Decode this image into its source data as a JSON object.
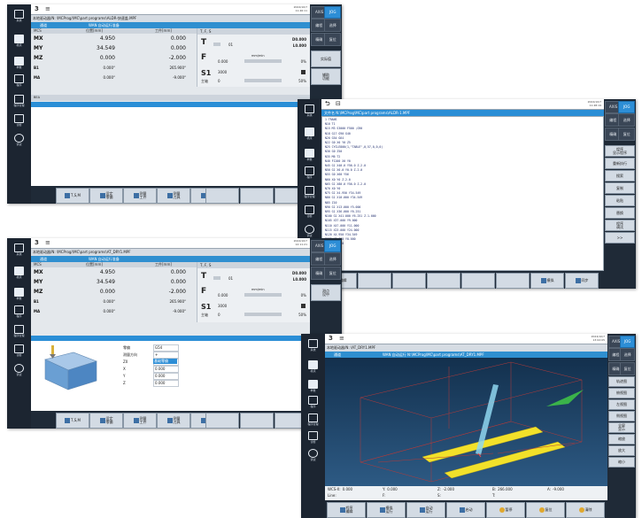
{
  "w1": {
    "title_sym": "3",
    "title_icon": "≡",
    "datetime": "2024/10/7\n11:46:11",
    "path": "本地驱动器/N: \\MCProg/\\MC\\part programs\\ALDR-快速盖.MPF",
    "status_left": "通道",
    "status_right": "WAN 自动运行准备",
    "col_mcs": "MCS",
    "col_pos": "位置[mm]",
    "col_work": "工件[mm]",
    "col_tfs": "T, F, S",
    "axes": [
      {
        "n": "MX",
        "v1": "4.950",
        "v2": "0.000"
      },
      {
        "n": "MY",
        "v1": "34.549",
        "v2": "0.000"
      },
      {
        "n": "MZ",
        "v1": "0.000",
        "v2": "-2.000"
      },
      {
        "n": "B1",
        "v1": "0.000°",
        "v2": "265.900°"
      },
      {
        "n": "MA",
        "v1": "0.000°",
        "v2": "-9.000°"
      }
    ],
    "t_label": "T",
    "t_val": "01",
    "t_d": "D0.000",
    "t_l": "L0.000",
    "f_label": "F",
    "f_val": "0.000",
    "f_unit": "mm/min",
    "f_pct": "0%",
    "s_label": "S1",
    "s_val": "3000",
    "s_pct": "50%",
    "spindle": "主轴",
    "spindle_val": "0",
    "row_bar": "BEA",
    "right_top": [
      "AXIS",
      "JOG"
    ],
    "right_btns": [
      "编程",
      "选择",
      "精确",
      "复位",
      "实际值",
      "辅助\n功能"
    ],
    "bottom_btns": [
      "T,S,M",
      "设定\n零偏",
      "测量\n工件",
      "测量\n刀具",
      "位置"
    ]
  },
  "w2": {
    "title_sym": "⮌",
    "title_icon": "⊟",
    "datetime": "2024/10/7\n11:48:19",
    "path": "文件名  N:\\MCProg\\MC\\part programs\\ALDR-1.MPF",
    "code": [
      "1 TRANS",
      "N10 T1",
      "N15 M3 S3000 F500 ;G90",
      "N18 G17 G90 G40",
      "N20 G54 G64",
      "N22 G0 X0 Y0 Z5",
      "N25 CYCLE800(1,\"TABLE\",0,57,0,0,0)",
      "N30 G0 Z50",
      "N35 M6 T2",
      "N40 F1200 X0 Y0",
      "N45 G1 X40.0 Y56.0 Z-2.0",
      "N50 G1 X0.0 Y0.0 Z-2.0",
      "N55 G0 X60 Y56",
      "N60 X0 Y0 Z-2.0",
      "N65 G1 X80.0 Y56.0 Z-2.0",
      "N70 X0 Y0",
      "N75 G1 X4.950 Y34.549",
      "N80 G1 X10.000 Y34.549",
      "N85 Z10",
      "N90 G1 X13.000 Y5.000",
      "N95 G1 X36.000 Y6.251",
      "N100 G1 X41.000 Y6.251 Z-1.000",
      "N105 X37.000 Y9.000",
      "N110 X47.000 Y11.000",
      "N115 X23.000 Y24.000",
      "N120 X4.950 Y34.549",
      "N125 X0.000 Y0.000",
      "N130 G0 Z50",
      "N135 M30",
      "N140 Z50"
    ],
    "right_top": [
      "AXIS",
      "JOG"
    ],
    "right_btns": [
      "编程",
      "选择",
      "精确",
      "复位",
      "程序\n显示程序",
      "重新执行",
      "搜索",
      "复制",
      "粘贴",
      "替换",
      "程序\n调试",
      ">>"
    ],
    "bottom_btns": [
      "编辑",
      "模拟",
      "同步"
    ]
  },
  "w3": {
    "title_sym": "3",
    "title_icon": "≡",
    "datetime": "2024/10/7\n12:11:21",
    "path": "本地驱动器/N: \\MCProg/\\MC\\part programs\\AT_DRY1.MPF",
    "status_left": "通道",
    "status_right": "WAN 自动运行准备",
    "col_mcs": "MCS",
    "col_pos": "位置[mm]",
    "col_work": "工件[mm]",
    "col_tfs": "T, F, S",
    "axes": [
      {
        "n": "MX",
        "v1": "4.950",
        "v2": "0.000"
      },
      {
        "n": "MY",
        "v1": "34.549",
        "v2": "0.000"
      },
      {
        "n": "MZ",
        "v1": "0.000",
        "v2": "-2.000"
      },
      {
        "n": "B1",
        "v1": "0.000°",
        "v2": "265.900°"
      },
      {
        "n": "MA",
        "v1": "0.000°",
        "v2": "-9.000°"
      }
    ],
    "t_label": "T",
    "t_val": "01",
    "t_d": "D0.000",
    "t_l": "L0.000",
    "f_label": "F",
    "f_val": "0.000",
    "f_unit": "mm/min",
    "f_pct": "0%",
    "s_label": "S1",
    "s_val": "3000",
    "s_pct": "50%",
    "spindle": "主轴",
    "spindle_val": "0",
    "form_labels": [
      "零偏",
      "测量方向",
      "Z0",
      "X",
      "Y",
      "Z"
    ],
    "form_vals": [
      "G54",
      "+",
      "0.000",
      "0.000",
      "0.000",
      "0.000"
    ],
    "form_selected": "基础零偏",
    "right_top": [
      "AXIS",
      "JOG"
    ],
    "right_btns": [
      "编程",
      "选择",
      "精确",
      "复位",
      "测点\n设中"
    ],
    "bottom_btns": [
      "T,S,M",
      "设定\n零偏",
      "测量\n工件",
      "测量\n刀具",
      "位置"
    ]
  },
  "w4": {
    "title_sym": "3",
    "title_icon": "≡",
    "datetime": "2024/10/7\n13:02:05",
    "path": "本地驱动器/N: \\AT_DRY1.MPF",
    "status_left": "通道",
    "status_right": "WAN 自动运行 N:\\MCProg\\MC\\part programs\\AT_DRY1.MPF",
    "readout": [
      {
        "k": "WCS-X:",
        "v": "0.000"
      },
      {
        "k": "Y:",
        "v": "0.000"
      },
      {
        "k": "Z:",
        "v": "-2.000"
      },
      {
        "k": "B:",
        "v": "266.000"
      },
      {
        "k": "A:",
        "v": "-9.000"
      }
    ],
    "readout2": [
      {
        "k": "Line:",
        "v": ""
      },
      {
        "k": "F:",
        "v": ""
      },
      {
        "k": "S:",
        "v": ""
      },
      {
        "k": "T:",
        "v": ""
      }
    ],
    "right_top": [
      "AXIS",
      "JOG"
    ],
    "right_btns": [
      "编程",
      "选择",
      "精确",
      "复位",
      "轨迹图",
      "俯视图",
      "左视图",
      "侧视图",
      "全屏\n显示",
      "缩放",
      "放大",
      "缩小"
    ],
    "bottom_btns": [
      "程序\n编辑",
      "模拟\n运行",
      "自动\n运行",
      "启动",
      "暂停",
      "复位",
      "清除"
    ]
  },
  "colors": {
    "accent": "#2d8ed6",
    "dark": "#1c2531",
    "bar_yellow": "#f2e12a",
    "tool": "#8fd6ee",
    "arrow": "#3bb34a"
  }
}
